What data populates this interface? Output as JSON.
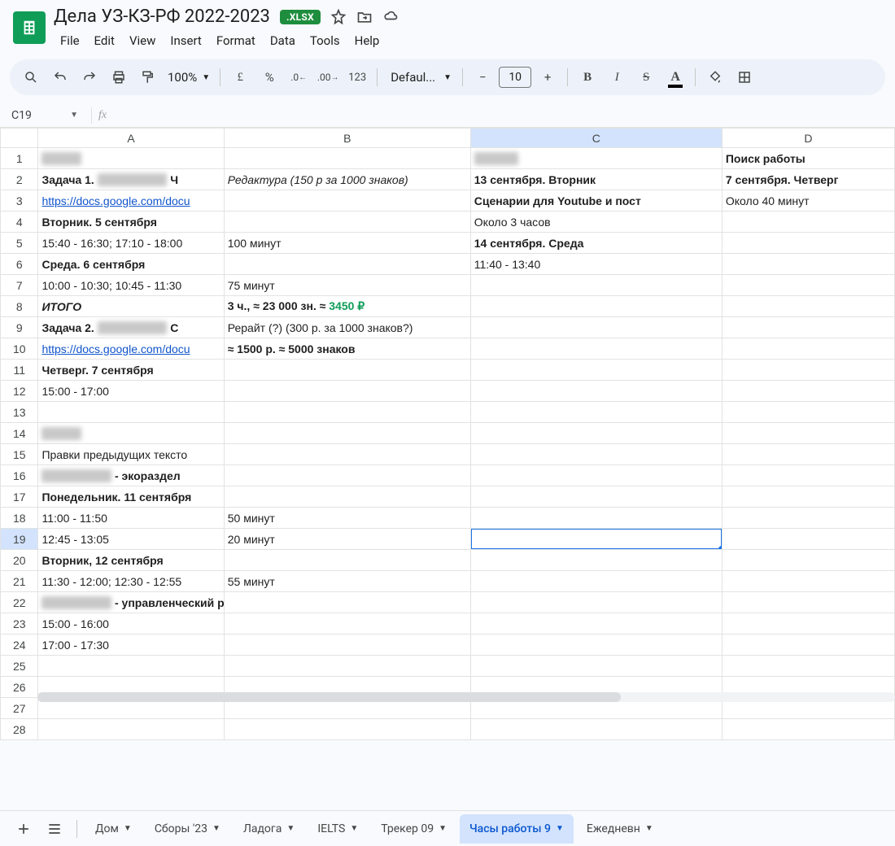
{
  "doc": {
    "title": "Дела УЗ-КЗ-РФ 2022-2023",
    "badge": ".XLSX"
  },
  "menus": [
    "File",
    "Edit",
    "View",
    "Insert",
    "Format",
    "Data",
    "Tools",
    "Help"
  ],
  "toolbar": {
    "zoom": "100%",
    "font": "Defaul...",
    "fontsize": "10"
  },
  "namebox": "C19",
  "columns": [
    "A",
    "B",
    "C",
    "D"
  ],
  "active_col_index": 2,
  "active_row": 19,
  "rows": [
    {
      "n": 1,
      "A": {
        "t": "",
        "blur": true
      },
      "C": {
        "t": "",
        "blur": true,
        "bold": true
      },
      "D": {
        "t": "Поиск работы",
        "cls": "col-d-header"
      }
    },
    {
      "n": 2,
      "A": {
        "t": "Задача 1. ",
        "blur_after": true,
        "extra": "Ч",
        "bold": true
      },
      "B": {
        "t": "Редактура (150 р за 1000 знаков)",
        "italic": true
      },
      "C": {
        "t": "13 сентября. Вторник",
        "bold": true
      },
      "D": {
        "t": "7 сентября. Четверг",
        "bold": true
      }
    },
    {
      "n": 3,
      "A": {
        "t": "https://docs.google.com/docu",
        "link": true
      },
      "C": {
        "t": "Сценарии для Youtube и пост",
        "bold": true
      },
      "D": {
        "t": "Около 40 минут"
      }
    },
    {
      "n": 4,
      "A": {
        "t": "Вторник. 5 сентября",
        "bold": true
      },
      "C": {
        "t": "Около 3 часов"
      }
    },
    {
      "n": 5,
      "A": {
        "t": "15:40 - 16:30; 17:10 - 18:00"
      },
      "B": {
        "t": "100 минут"
      },
      "C": {
        "t": "14 сентября. Среда",
        "bold": true
      }
    },
    {
      "n": 6,
      "A": {
        "t": "Среда. 6 сентября",
        "bold": true
      },
      "C": {
        "t": "11:40 - 13:40"
      }
    },
    {
      "n": 7,
      "A": {
        "t": "10:00 - 10:30; 10:45 - 11:30"
      },
      "B": {
        "t": "75 минут"
      }
    },
    {
      "n": 8,
      "A": {
        "t": "ИТОГО",
        "bold": true,
        "italic": true
      },
      "B": {
        "html": "<b>3 ч., ≈ 23 000 зн. ≈ </b><span class='green-money'>3450 ₽</span>"
      }
    },
    {
      "n": 9,
      "A": {
        "t": "Задача 2. ",
        "blur_after": true,
        "extra": "С",
        "bold": true
      },
      "B": {
        "t": "Рерайт (?) (300 р. за 1000 знаков?)"
      }
    },
    {
      "n": 10,
      "A": {
        "t": "https://docs.google.com/docu",
        "link": true
      },
      "B": {
        "t": "≈ 1500 р. ≈ 5000 знаков",
        "bold": true
      }
    },
    {
      "n": 11,
      "A": {
        "t": "Четверг. 7 сентября",
        "bold": true
      }
    },
    {
      "n": 12,
      "A": {
        "t": "15:00 - 17:00"
      }
    },
    {
      "n": 13
    },
    {
      "n": 14,
      "A": {
        "t": "",
        "blur": true
      }
    },
    {
      "n": 15,
      "A": {
        "t": "Правки предыдущих тексто"
      }
    },
    {
      "n": 16,
      "A": {
        "blur_before": true,
        "t": " - экораздел",
        "bold": true
      }
    },
    {
      "n": 17,
      "A": {
        "t": "Понедельник. 11 сентября",
        "bold": true
      }
    },
    {
      "n": 18,
      "A": {
        "t": "11:00 - 11:50"
      },
      "B": {
        "t": "50 минут"
      }
    },
    {
      "n": 19,
      "A": {
        "t": "12:45 - 13:05"
      },
      "B": {
        "t": "20 минут"
      },
      "C": {
        "selected": true
      }
    },
    {
      "n": 20,
      "A": {
        "t": "Вторник, 12 сентября",
        "bold": true
      }
    },
    {
      "n": 21,
      "A": {
        "t": "11:30 - 12:00; 12:30 - 12:55"
      },
      "B": {
        "t": "55 минут"
      }
    },
    {
      "n": 22,
      "A": {
        "blur_before": true,
        "t": " - управленческий раздел",
        "bold": true
      }
    },
    {
      "n": 23,
      "A": {
        "t": "15:00 - 16:00"
      }
    },
    {
      "n": 24,
      "A": {
        "t": "17:00 - 17:30"
      }
    },
    {
      "n": 25
    },
    {
      "n": 26
    },
    {
      "n": 27
    },
    {
      "n": 28
    }
  ],
  "tabs": [
    {
      "label": "Дом"
    },
    {
      "label": "Сборы '23"
    },
    {
      "label": "Ладога"
    },
    {
      "label": "IELTS"
    },
    {
      "label": "Трекер 09"
    },
    {
      "label": "Часы работы 9",
      "active": true
    },
    {
      "label": "Ежедневн"
    }
  ]
}
